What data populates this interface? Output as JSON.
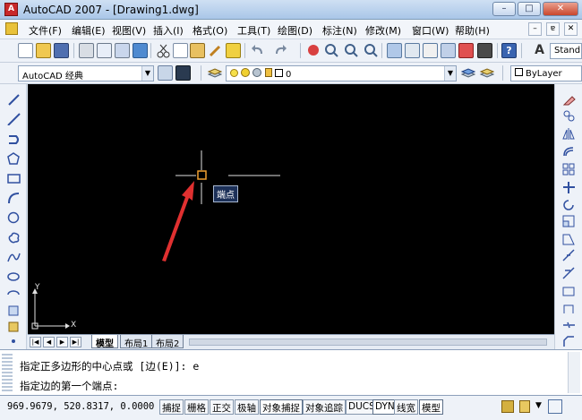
{
  "window": {
    "title": "AutoCAD 2007 - [Drawing1.dwg]",
    "app_icon": "A",
    "controls": [
      "–",
      "□",
      "✕"
    ]
  },
  "menu": {
    "items": [
      "文件(F)",
      "编辑(E)",
      "视图(V)",
      "插入(I)",
      "格式(O)",
      "工具(T)",
      "绘图(D)",
      "标注(N)",
      "修改(M)",
      "窗口(W)",
      "帮助(H)"
    ],
    "mdi_controls": [
      "–",
      "ɐ",
      "✕"
    ]
  },
  "toolbar": {
    "text_style": "Stand"
  },
  "workspace": {
    "name": "AutoCAD 经典"
  },
  "layer": {
    "current": "0"
  },
  "color": {
    "current": "ByLayer"
  },
  "canvas": {
    "tooltip": "端点",
    "ucs_y": "Y",
    "ucs_x": "X",
    "colors": {
      "background": "#000000",
      "crosshair": "#e0e0e0",
      "arrow": "#e03030",
      "snap": "#f0a030"
    }
  },
  "layout_tabs": [
    "模型",
    "布局1",
    "布局2"
  ],
  "command": {
    "line1": "指定正多边形的中心点或 [边(E)]: e",
    "line2": "指定边的第一个端点:"
  },
  "status": {
    "coordinates": "969.9679,  520.8317, 0.0000",
    "toggles": [
      "捕捉",
      "栅格",
      "正交",
      "极轴",
      "对象捕捉",
      "对象追踪",
      "DUCS",
      "DYN",
      "线宽",
      "模型"
    ]
  }
}
